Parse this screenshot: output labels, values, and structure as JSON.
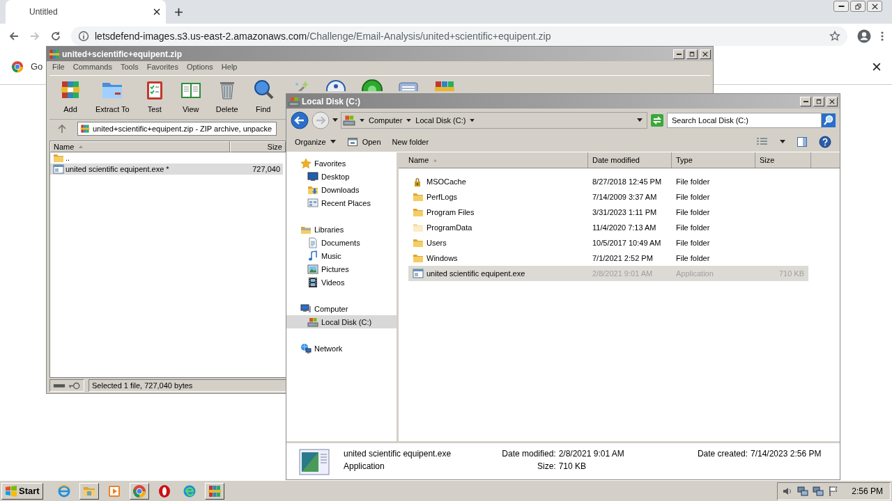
{
  "browser": {
    "tabs": [
      {
        "title": "Untitled",
        "selected": true
      }
    ],
    "address": {
      "host": "letsdefend-images.s3.us-east-2.amazonaws.com",
      "path": "/Challenge/Email-Analysis/united+scientific+equipent.zip"
    },
    "infobar": {
      "text": "Go"
    }
  },
  "winrar": {
    "title": "united+scientific+equipent.zip",
    "menu": [
      "File",
      "Commands",
      "Tools",
      "Favorites",
      "Options",
      "Help"
    ],
    "toolbar": [
      {
        "kind": "add",
        "label": "Add"
      },
      {
        "kind": "extract",
        "label": "Extract To"
      },
      {
        "kind": "test",
        "label": "Test"
      },
      {
        "kind": "view",
        "label": "View"
      },
      {
        "kind": "delete",
        "label": "Delete"
      },
      {
        "kind": "find",
        "label": "Find"
      },
      {
        "kind": "wizard"
      },
      {
        "kind": "info"
      },
      {
        "kind": "virus"
      },
      {
        "kind": "comment"
      },
      {
        "kind": "sfx"
      }
    ],
    "path": "united+scientific+equipent.zip - ZIP archive, unpacke",
    "columns": [
      "Name",
      "Size"
    ],
    "rows": [
      {
        "kind": "parent",
        "name": "..",
        "selected": false
      },
      {
        "kind": "app",
        "name": "united scientific equipent.exe *",
        "size": "727,040",
        "selected": true
      }
    ],
    "status": "Selected 1 file, 727,040 bytes"
  },
  "explorer": {
    "title": "Local Disk (C:)",
    "breadcrumb": [
      "Computer",
      "Local Disk (C:)"
    ],
    "search": {
      "placeholder": "Search Local Disk (C:)"
    },
    "commands": [
      {
        "kind": "menu",
        "label": "Organize"
      },
      {
        "kind": "open",
        "label": "Open"
      },
      {
        "kind": "plain",
        "label": "New folder"
      }
    ],
    "nav": [
      {
        "kind": "favorites",
        "label": "Favorites",
        "selected": false,
        "children": [
          {
            "kind": "desktop",
            "label": "Desktop",
            "selected": false
          },
          {
            "kind": "downloads",
            "label": "Downloads",
            "selected": false
          },
          {
            "kind": "recent",
            "label": "Recent Places",
            "selected": false
          }
        ]
      },
      {
        "kind": "libraries",
        "label": "Libraries",
        "selected": false,
        "children": [
          {
            "kind": "documents",
            "label": "Documents",
            "selected": false
          },
          {
            "kind": "music",
            "label": "Music",
            "selected": false
          },
          {
            "kind": "pictures",
            "label": "Pictures",
            "selected": false
          },
          {
            "kind": "videos",
            "label": "Videos",
            "selected": false
          }
        ]
      },
      {
        "kind": "computer",
        "label": "Computer",
        "selected": false,
        "children": [
          {
            "kind": "disk",
            "label": "Local Disk (C:)",
            "selected": true
          }
        ]
      },
      {
        "kind": "network",
        "label": "Network",
        "selected": false
      }
    ],
    "columns": [
      "Name",
      "Date modified",
      "Type",
      "Size"
    ],
    "rows": [
      {
        "kind": "locked-folder",
        "name": "MSOCache",
        "date": "8/27/2018 12:45 PM",
        "type": "File folder",
        "selected": false
      },
      {
        "kind": "folder",
        "name": "PerfLogs",
        "date": "7/14/2009 3:37 AM",
        "type": "File folder",
        "selected": false
      },
      {
        "kind": "folder",
        "name": "Program Files",
        "date": "3/31/2023 1:11 PM",
        "type": "File folder",
        "selected": false
      },
      {
        "kind": "hidden-folder",
        "name": "ProgramData",
        "date": "11/4/2020 7:13 AM",
        "type": "File folder",
        "selected": false
      },
      {
        "kind": "folder",
        "name": "Users",
        "date": "10/5/2017 10:49 AM",
        "type": "File folder",
        "selected": false
      },
      {
        "kind": "folder",
        "name": "Windows",
        "date": "7/1/2021 2:52 PM",
        "type": "File folder",
        "selected": false
      },
      {
        "kind": "app",
        "name": "united scientific equipent.exe",
        "date": "2/8/2021 9:01 AM",
        "type": "Application",
        "size": "710 KB",
        "selected": true
      }
    ],
    "details": {
      "name": "united scientific equipent.exe",
      "type": "Application",
      "modified_label": "Date modified:",
      "modified": "2/8/2021 9:01 AM",
      "size_label": "Size:",
      "size": "710 KB",
      "created_label": "Date created:",
      "created": "7/14/2023 2:56 PM"
    }
  },
  "taskbar": {
    "start": "Start",
    "apps": [
      {
        "kind": "ie",
        "open": false
      },
      {
        "kind": "explorer",
        "open": true
      },
      {
        "kind": "media",
        "open": false
      },
      {
        "kind": "chrome",
        "open": true
      },
      {
        "kind": "opera",
        "open": false
      },
      {
        "kind": "edge",
        "open": false
      },
      {
        "kind": "winrar",
        "open": true
      }
    ],
    "clock": "2:56 PM"
  }
}
